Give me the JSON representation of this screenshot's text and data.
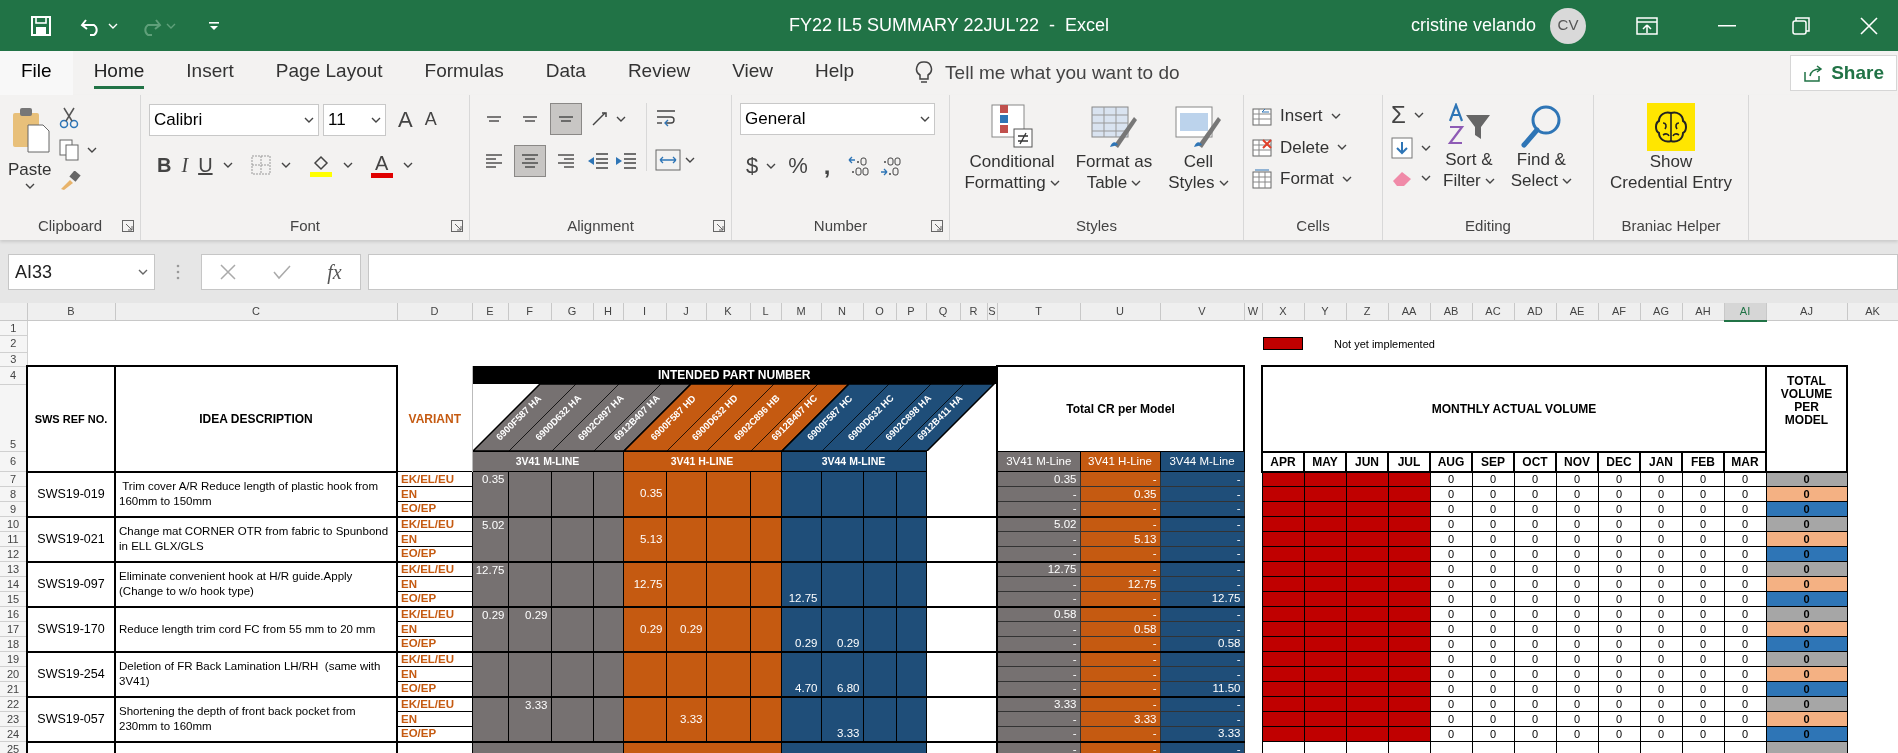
{
  "window": {
    "title": "FY22 IL5 SUMMARY 22JUL'22  -  Excel",
    "user": "cristine velando",
    "avatar": "CV"
  },
  "tabs": [
    {
      "label": "File",
      "selected": false
    },
    {
      "label": "Home",
      "selected": true
    },
    {
      "label": "Insert",
      "selected": false
    },
    {
      "label": "Page Layout",
      "selected": false
    },
    {
      "label": "Formulas",
      "selected": false
    },
    {
      "label": "Data",
      "selected": false
    },
    {
      "label": "Review",
      "selected": false
    },
    {
      "label": "View",
      "selected": false
    },
    {
      "label": "Help",
      "selected": false
    }
  ],
  "tell_me": {
    "placeholder": "Tell me what you want to do"
  },
  "share": "Share",
  "ribbon": {
    "clipboard": {
      "label": "Clipboard",
      "paste": "Paste"
    },
    "font": {
      "label": "Font",
      "font_name": "Calibri",
      "font_size": "11",
      "grow": "A",
      "shrink": "A",
      "bold": "B",
      "italic": "I",
      "underline": "U",
      "font_color": "A"
    },
    "alignment": {
      "label": "Alignment",
      "buttons": [
        {
          "selected": false
        },
        {
          "selected": false
        },
        {
          "selected": true
        },
        {
          "selected": false
        },
        {
          "selected": true
        },
        {
          "selected": false
        }
      ]
    },
    "number": {
      "label": "Number",
      "format": "General",
      "currency": "$",
      "percent": "%",
      "comma": ","
    },
    "styles": {
      "label": "Styles",
      "buttons": [
        [
          "Conditional",
          "Formatting"
        ],
        [
          "Format as",
          "Table"
        ],
        [
          "Cell",
          "Styles"
        ]
      ]
    },
    "cells": {
      "label": "Cells",
      "buttons": [
        "Insert",
        "Delete",
        "Format"
      ]
    },
    "editing": {
      "label": "Editing",
      "sigma": "Σ",
      "buttons": [
        [
          "Sort &",
          "Filter"
        ],
        [
          "Find &",
          "Select"
        ]
      ]
    },
    "braniac": {
      "label": "Braniac Helper",
      "button": [
        "Show",
        "Credential Entry"
      ]
    }
  },
  "formula_bar": {
    "name_box": "AI33",
    "fx": "fx"
  },
  "sheet": {
    "columns": [
      {
        "label": "B",
        "selected": false
      },
      {
        "label": "C",
        "selected": false
      },
      {
        "label": "D",
        "selected": false
      },
      {
        "label": "E",
        "selected": false
      },
      {
        "label": "F",
        "selected": false
      },
      {
        "label": "G",
        "selected": false
      },
      {
        "label": "H",
        "selected": false
      },
      {
        "label": "I",
        "selected": false
      },
      {
        "label": "J",
        "selected": false
      },
      {
        "label": "K",
        "selected": false
      },
      {
        "label": "L",
        "selected": false
      },
      {
        "label": "M",
        "selected": false
      },
      {
        "label": "N",
        "selected": false
      },
      {
        "label": "O",
        "selected": false
      },
      {
        "label": "P",
        "selected": false
      },
      {
        "label": "Q",
        "selected": false
      },
      {
        "label": "R",
        "selected": false
      },
      {
        "label": "S",
        "selected": false
      },
      {
        "label": "T",
        "selected": false
      },
      {
        "label": "U",
        "selected": false
      },
      {
        "label": "V",
        "selected": false
      },
      {
        "label": "W",
        "selected": false
      },
      {
        "label": "X",
        "selected": false
      },
      {
        "label": "Y",
        "selected": false
      },
      {
        "label": "Z",
        "selected": false
      },
      {
        "label": "AA",
        "selected": false
      },
      {
        "label": "AB",
        "selected": false
      },
      {
        "label": "AC",
        "selected": false
      },
      {
        "label": "AD",
        "selected": false
      },
      {
        "label": "AE",
        "selected": false
      },
      {
        "label": "AF",
        "selected": false
      },
      {
        "label": "AG",
        "selected": false
      },
      {
        "label": "AH",
        "selected": false
      },
      {
        "label": "AI",
        "selected": true
      },
      {
        "label": "AJ",
        "selected": false
      },
      {
        "label": "AK",
        "selected": false
      }
    ],
    "row_numbers": [
      "1",
      "2",
      "3",
      "4",
      "5",
      "6",
      "7",
      "8",
      "9",
      "10",
      "11",
      "12",
      "13",
      "14",
      "15",
      "16",
      "17",
      "18",
      "19",
      "20",
      "21",
      "22",
      "23",
      "24",
      "25"
    ],
    "legend": {
      "color": "#c00000",
      "label": "Not yet implemented"
    },
    "headers": {
      "ref": "SWS REF NO.",
      "description": "IDEA DESCRIPTION",
      "variant": "VARIANT",
      "intended": "INTENDED PART NUMBER",
      "total_cr": "Total CR per Model",
      "monthly": "MONTHLY ACTUAL VOLUME",
      "total_volume": "TOTAL VOLUME PER MODEL"
    },
    "models": [
      {
        "line_label": "3V41 M-LINE",
        "cr_label": "3V41 M-Line",
        "part_numbers": [
          "6900F587 HA",
          "6900D632 HA",
          "6902C897 HA",
          "6912B407 HA"
        ]
      },
      {
        "line_label": "3V41 H-LINE",
        "cr_label": "3V41 H-Line",
        "part_numbers": [
          "6900F587 HD",
          "6900D632 HD",
          "6902C896 HB",
          "6912B407 HC"
        ]
      },
      {
        "line_label": "3V44 M-LINE",
        "cr_label": "3V44 M-Line",
        "part_numbers": [
          "6900F587 HC",
          "6900D632 HC",
          "6902C898 HA",
          "6912B411 HA"
        ]
      }
    ],
    "months": [
      {
        "label": "APR",
        "implemented": false
      },
      {
        "label": "MAY",
        "implemented": false
      },
      {
        "label": "JUN",
        "implemented": false
      },
      {
        "label": "JUL",
        "implemented": false
      },
      {
        "label": "AUG",
        "implemented": true
      },
      {
        "label": "SEP",
        "implemented": true
      },
      {
        "label": "OCT",
        "implemented": true
      },
      {
        "label": "NOV",
        "implemented": true
      },
      {
        "label": "DEC",
        "implemented": true
      },
      {
        "label": "JAN",
        "implemented": true
      },
      {
        "label": "FEB",
        "implemented": true
      },
      {
        "label": "MAR",
        "implemented": true
      }
    ],
    "ideas": [
      {
        "ref": "SWS19-019",
        "description": " Trim cover A/R Reduce length of plastic hook from 160mm to 150mm",
        "parts": [
          [
            {
              "kind": "value",
              "value": "0.35"
            },
            {
              "kind": "blank"
            },
            {
              "kind": "blank"
            },
            {
              "kind": "blank"
            }
          ],
          [
            {
              "kind": "value",
              "value": "0.35"
            },
            {
              "kind": "blank"
            },
            {
              "kind": "blank"
            },
            {
              "kind": "blank"
            }
          ],
          [
            {
              "kind": "blank"
            },
            {
              "kind": "blank"
            },
            {
              "kind": "blank"
            },
            {
              "kind": "blank"
            }
          ]
        ],
        "variants": [
          {
            "label": "EK/EL/EU",
            "cr": [
              "0.35",
              "-",
              "-"
            ],
            "volumes": [
              "0",
              "0",
              "0",
              "0",
              "0",
              "0",
              "0",
              "0"
            ],
            "total": "0"
          },
          {
            "label": "EN",
            "cr": [
              "-",
              "0.35",
              "-"
            ],
            "volumes": [
              "0",
              "0",
              "0",
              "0",
              "0",
              "0",
              "0",
              "0"
            ],
            "total": "0"
          },
          {
            "label": "EO/EP",
            "cr": [
              "-",
              "-",
              "-"
            ],
            "volumes": [
              "0",
              "0",
              "0",
              "0",
              "0",
              "0",
              "0",
              "0"
            ],
            "total": "0"
          }
        ]
      },
      {
        "ref": "SWS19-021",
        "description": "Change mat CORNER OTR from fabric to Spunbond in ELL GLX/GLS",
        "parts": [
          [
            {
              "kind": "value",
              "value": "5.02"
            },
            {
              "kind": "blank"
            },
            {
              "kind": "blank"
            },
            {
              "kind": "blank"
            }
          ],
          [
            {
              "kind": "value",
              "value": "5.13"
            },
            {
              "kind": "blank"
            },
            {
              "kind": "blank"
            },
            {
              "kind": "blank"
            }
          ],
          [
            {
              "kind": "blank"
            },
            {
              "kind": "blank"
            },
            {
              "kind": "blank"
            },
            {
              "kind": "blank"
            }
          ]
        ],
        "variants": [
          {
            "label": "EK/EL/EU",
            "cr": [
              "5.02",
              "-",
              "-"
            ],
            "volumes": [
              "0",
              "0",
              "0",
              "0",
              "0",
              "0",
              "0",
              "0"
            ],
            "total": "0"
          },
          {
            "label": "EN",
            "cr": [
              "-",
              "5.13",
              "-"
            ],
            "volumes": [
              "0",
              "0",
              "0",
              "0",
              "0",
              "0",
              "0",
              "0"
            ],
            "total": "0"
          },
          {
            "label": "EO/EP",
            "cr": [
              "-",
              "-",
              "-"
            ],
            "volumes": [
              "0",
              "0",
              "0",
              "0",
              "0",
              "0",
              "0",
              "0"
            ],
            "total": "0"
          }
        ]
      },
      {
        "ref": "SWS19-097",
        "description": "Eliminate convenient hook at H/R guide.Apply (Change to w/o hook type)",
        "parts": [
          [
            {
              "kind": "value",
              "value": "12.75"
            },
            {
              "kind": "blank"
            },
            {
              "kind": "blank"
            },
            {
              "kind": "blank"
            }
          ],
          [
            {
              "kind": "value",
              "value": "12.75"
            },
            {
              "kind": "blank"
            },
            {
              "kind": "blank"
            },
            {
              "kind": "blank"
            }
          ],
          [
            {
              "kind": "value",
              "value": "12.75"
            },
            {
              "kind": "blank"
            },
            {
              "kind": "blank"
            },
            {
              "kind": "blank"
            }
          ]
        ],
        "variants": [
          {
            "label": "EK/EL/EU",
            "cr": [
              "12.75",
              "-",
              "-"
            ],
            "volumes": [
              "0",
              "0",
              "0",
              "0",
              "0",
              "0",
              "0",
              "0"
            ],
            "total": "0"
          },
          {
            "label": "EN",
            "cr": [
              "-",
              "12.75",
              "-"
            ],
            "volumes": [
              "0",
              "0",
              "0",
              "0",
              "0",
              "0",
              "0",
              "0"
            ],
            "total": "0"
          },
          {
            "label": "EO/EP",
            "cr": [
              "-",
              "-",
              "12.75"
            ],
            "volumes": [
              "0",
              "0",
              "0",
              "0",
              "0",
              "0",
              "0",
              "0"
            ],
            "total": "0"
          }
        ]
      },
      {
        "ref": "SWS19-170",
        "description": "Reduce length trim cord FC from 55 mm to 20 mm",
        "parts": [
          [
            {
              "kind": "value",
              "value": "0.29"
            },
            {
              "kind": "value",
              "value": "0.29"
            },
            {
              "kind": "blank"
            },
            {
              "kind": "blank"
            }
          ],
          [
            {
              "kind": "value",
              "value": "0.29"
            },
            {
              "kind": "value",
              "value": "0.29"
            },
            {
              "kind": "blank"
            },
            {
              "kind": "blank"
            }
          ],
          [
            {
              "kind": "value",
              "value": "0.29"
            },
            {
              "kind": "value",
              "value": "0.29"
            },
            {
              "kind": "blank"
            },
            {
              "kind": "blank"
            }
          ]
        ],
        "variants": [
          {
            "label": "EK/EL/EU",
            "cr": [
              "0.58",
              "-",
              "-"
            ],
            "volumes": [
              "0",
              "0",
              "0",
              "0",
              "0",
              "0",
              "0",
              "0"
            ],
            "total": "0"
          },
          {
            "label": "EN",
            "cr": [
              "-",
              "0.58",
              "-"
            ],
            "volumes": [
              "0",
              "0",
              "0",
              "0",
              "0",
              "0",
              "0",
              "0"
            ],
            "total": "0"
          },
          {
            "label": "EO/EP",
            "cr": [
              "-",
              "-",
              "0.58"
            ],
            "volumes": [
              "0",
              "0",
              "0",
              "0",
              "0",
              "0",
              "0",
              "0"
            ],
            "total": "0"
          }
        ]
      },
      {
        "ref": "SWS19-254",
        "description": "Deletion of FR Back Lamination LH/RH  (same with 3V41)",
        "parts": [
          [
            {
              "kind": "blank"
            },
            {
              "kind": "blank"
            },
            {
              "kind": "blank"
            },
            {
              "kind": "blank"
            }
          ],
          [
            {
              "kind": "blank"
            },
            {
              "kind": "blank"
            },
            {
              "kind": "blank"
            },
            {
              "kind": "blank"
            }
          ],
          [
            {
              "kind": "value",
              "value": "4.70"
            },
            {
              "kind": "value",
              "value": "6.80"
            },
            {
              "kind": "blank"
            },
            {
              "kind": "blank"
            }
          ]
        ],
        "variants": [
          {
            "label": "EK/EL/EU",
            "cr": [
              "-",
              "-",
              "-"
            ],
            "volumes": [
              "0",
              "0",
              "0",
              "0",
              "0",
              "0",
              "0",
              "0"
            ],
            "total": "0"
          },
          {
            "label": "EN",
            "cr": [
              "-",
              "-",
              "-"
            ],
            "volumes": [
              "0",
              "0",
              "0",
              "0",
              "0",
              "0",
              "0",
              "0"
            ],
            "total": "0"
          },
          {
            "label": "EO/EP",
            "cr": [
              "-",
              "-",
              "11.50"
            ],
            "volumes": [
              "0",
              "0",
              "0",
              "0",
              "0",
              "0",
              "0",
              "0"
            ],
            "total": "0"
          }
        ]
      },
      {
        "ref": "SWS19-057",
        "description": "Shortening the depth of front back pocket from 230mm to 160mm",
        "parts": [
          [
            {
              "kind": "blank"
            },
            {
              "kind": "value",
              "value": "3.33"
            },
            {
              "kind": "blank"
            },
            {
              "kind": "blank"
            }
          ],
          [
            {
              "kind": "blank"
            },
            {
              "kind": "value",
              "value": "3.33"
            },
            {
              "kind": "blank"
            },
            {
              "kind": "blank"
            }
          ],
          [
            {
              "kind": "blank"
            },
            {
              "kind": "value",
              "value": "3.33"
            },
            {
              "kind": "blank"
            },
            {
              "kind": "blank"
            }
          ]
        ],
        "variants": [
          {
            "label": "EK/EL/EU",
            "cr": [
              "3.33",
              "-",
              "-"
            ],
            "volumes": [
              "0",
              "0",
              "0",
              "0",
              "0",
              "0",
              "0",
              "0"
            ],
            "total": "0"
          },
          {
            "label": "EN",
            "cr": [
              "-",
              "3.33",
              "-"
            ],
            "volumes": [
              "0",
              "0",
              "0",
              "0",
              "0",
              "0",
              "0",
              "0"
            ],
            "total": "0"
          },
          {
            "label": "EO/EP",
            "cr": [
              "-",
              "-",
              "3.33"
            ],
            "volumes": [
              "0",
              "0",
              "0",
              "0",
              "0",
              "0",
              "0",
              "0"
            ],
            "total": "0"
          }
        ]
      }
    ],
    "footer": {
      "cr": [
        "-",
        "-",
        "-"
      ]
    }
  }
}
